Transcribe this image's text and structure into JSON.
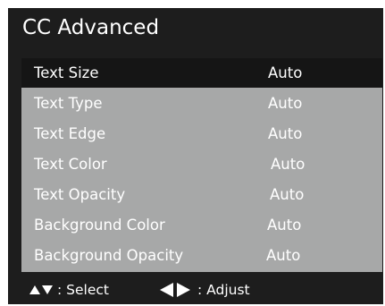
{
  "menu": {
    "title": "CC Advanced",
    "items": [
      {
        "label": "Text Size",
        "value": "Auto"
      },
      {
        "label": "Text Type",
        "value": "Auto"
      },
      {
        "label": "Text Edge",
        "value": "Auto"
      },
      {
        "label": "Text Color",
        "value": "Auto"
      },
      {
        "label": "Text Opacity",
        "value": "Auto"
      },
      {
        "label": "Background Color",
        "value": "Auto"
      },
      {
        "label": "Background Opacity",
        "value": "Auto"
      }
    ],
    "selected_index": 0
  },
  "footer": {
    "select_hint": ": Select",
    "adjust_hint": ": Adjust",
    "select_icon": "up-down-triangles-icon",
    "adjust_icon": "left-right-triangles-icon"
  },
  "colors": {
    "frame": "#1d1d1d",
    "panel": "#a7a8a8",
    "highlight": "#151515",
    "text": "#ffffff"
  }
}
